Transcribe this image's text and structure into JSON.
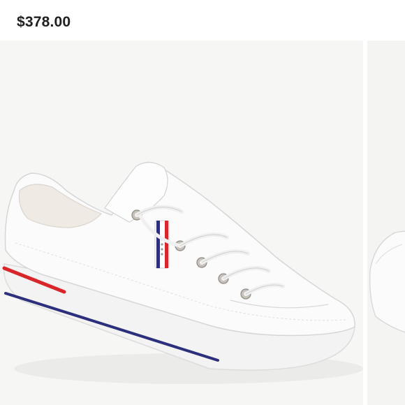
{
  "listing": {
    "price": "$378.00"
  },
  "gallery": {
    "current_image": "white-leather-low-top-sneaker",
    "next_image": "white-sneaker-alternate-view",
    "colors": {
      "background": "#f6f6f5",
      "shoe": "#fbfbfb",
      "red_stripe": "#d9262b",
      "blue_stripe": "#2c2f7c",
      "eyelet": "#b9b4ad"
    }
  }
}
